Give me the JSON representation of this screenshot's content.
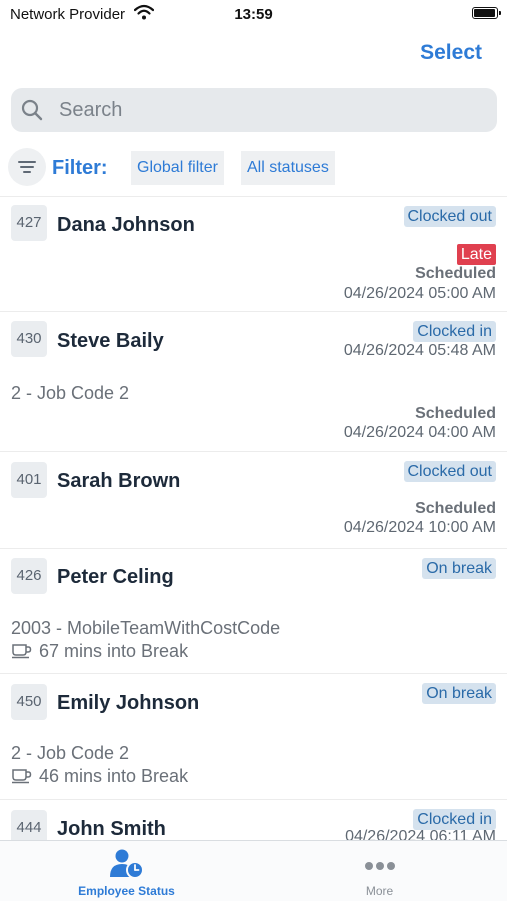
{
  "status_bar": {
    "carrier": "Network Provider",
    "time": "13:59"
  },
  "header": {
    "select_label": "Select"
  },
  "search": {
    "placeholder": "Search"
  },
  "filter": {
    "label": "Filter:",
    "global_chip": "Global filter",
    "status_chip": "All statuses"
  },
  "employees": [
    {
      "id": "427",
      "name": "Dana Johnson",
      "status": "Clocked out",
      "late": "Late",
      "scheduled_label": "Scheduled",
      "scheduled_time": "04/26/2024 05:00 AM"
    },
    {
      "id": "430",
      "name": "Steve Baily",
      "status": "Clocked in",
      "clock_time": "04/26/2024 05:48 AM",
      "job_code": "2 - Job Code 2",
      "scheduled_label": "Scheduled",
      "scheduled_time": "04/26/2024 04:00 AM"
    },
    {
      "id": "401",
      "name": "Sarah Brown",
      "status": "Clocked out",
      "scheduled_label": "Scheduled",
      "scheduled_time": "04/26/2024 10:00 AM"
    },
    {
      "id": "426",
      "name": "Peter Celing",
      "status": "On break",
      "job_code": "2003 - MobileTeamWithCostCode",
      "break_text": "67 mins into Break"
    },
    {
      "id": "450",
      "name": "Emily Johnson",
      "status": "On break",
      "job_code": "2 - Job Code 2",
      "break_text": "46 mins into Break"
    },
    {
      "id": "444",
      "name": "John Smith",
      "status": "Clocked in",
      "clock_time": "04/26/2024 06:11 AM"
    }
  ],
  "tabs": [
    {
      "label": "Employee Status",
      "icon": "employee-clock-icon",
      "active": true
    },
    {
      "label": "More",
      "icon": "more-dots-icon",
      "active": false
    }
  ],
  "colors": {
    "accent": "#2e7bd6",
    "badge_bg": "#d5e2ee",
    "late": "#e0404f"
  }
}
